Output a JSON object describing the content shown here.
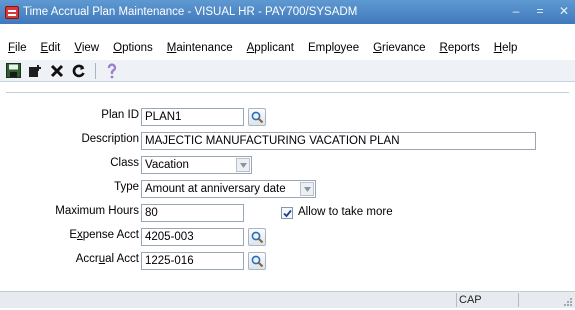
{
  "window": {
    "title": "Time Accrual Plan Maintenance - VISUAL HR - PAY700/SYSADM",
    "controls": [
      "–",
      "=",
      "✕"
    ]
  },
  "menu": [
    {
      "pre": "",
      "u": "F",
      "post": "ile"
    },
    {
      "pre": "",
      "u": "E",
      "post": "dit"
    },
    {
      "pre": "",
      "u": "V",
      "post": "iew"
    },
    {
      "pre": "",
      "u": "O",
      "post": "ptions"
    },
    {
      "pre": "",
      "u": "M",
      "post": "aintenance"
    },
    {
      "pre": "",
      "u": "A",
      "post": "pplicant"
    },
    {
      "pre": "Empl",
      "u": "o",
      "post": "yee"
    },
    {
      "pre": "",
      "u": "G",
      "post": "rievance"
    },
    {
      "pre": "",
      "u": "R",
      "post": "eports"
    },
    {
      "pre": "",
      "u": "H",
      "post": "elp"
    }
  ],
  "form": {
    "plan_id": {
      "label": "Plan ID",
      "value": "PLAN1"
    },
    "description": {
      "label": "Description",
      "value": "MAJECTIC MANUFACTURING VACATION PLAN"
    },
    "class": {
      "label": "Class",
      "value": "Vacation"
    },
    "type": {
      "label": "Type",
      "value": "Amount at anniversary date"
    },
    "max_hours": {
      "label": "Maximum Hours",
      "value": "80"
    },
    "allow_more": {
      "label": "Allow to take more",
      "checked": true
    },
    "expense_acct": {
      "label": "Expense Acct",
      "value": "4205-003"
    },
    "accrual_acct": {
      "label": "Accrual Acct",
      "value": "1225-016"
    }
  },
  "status": {
    "cap": "CAP"
  }
}
